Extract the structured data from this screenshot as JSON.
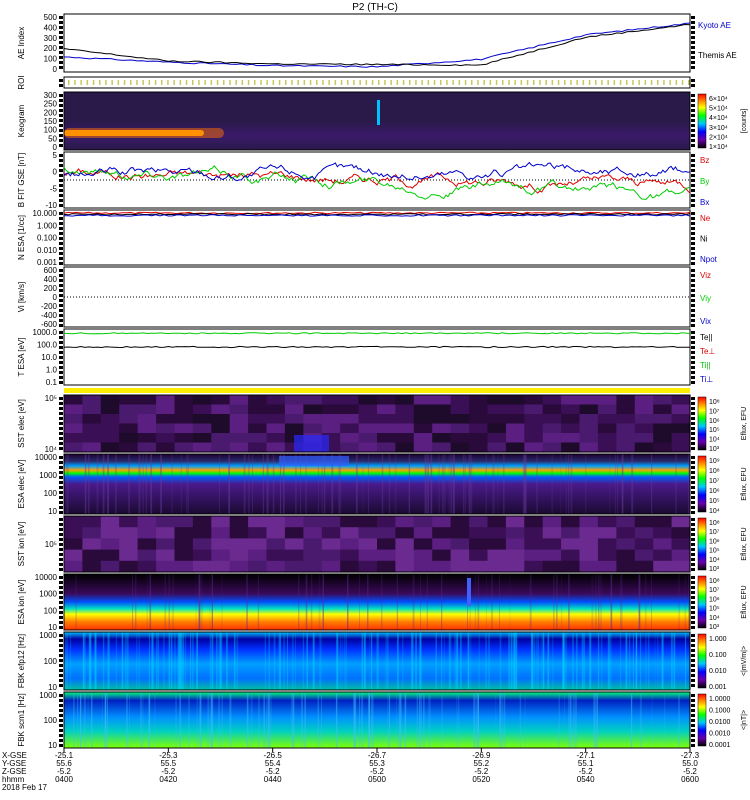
{
  "title": "P2 (TH-C)",
  "footer": {
    "row_labels": [
      "X-GSE",
      "Y-GSE",
      "Z-GSE",
      "hhmm",
      "2018 Feb 17"
    ],
    "columns": [
      {
        "values": [
          "-25.1",
          "55.6",
          "-5.2",
          "0400"
        ]
      },
      {
        "values": [
          "-25.3",
          "55.5",
          "-5.2",
          "0420"
        ]
      },
      {
        "values": [
          "-26.5",
          "55.4",
          "-5.2",
          "0440"
        ]
      },
      {
        "values": [
          "-26.7",
          "55.3",
          "-5.2",
          "0500"
        ]
      },
      {
        "values": [
          "-26.9",
          "55.2",
          "-5.2",
          "0520"
        ]
      },
      {
        "values": [
          "-27.1",
          "55.1",
          "-5.2",
          "0540"
        ]
      },
      {
        "values": [
          "-27.3",
          "55.0",
          "-5.2",
          "0600"
        ]
      }
    ]
  },
  "colors": {
    "blue": "#0000cc",
    "red": "#dd0000",
    "green": "#00cc00",
    "black": "#000000",
    "yellow": "#ffee00"
  },
  "chart_data": [
    {
      "type": "line",
      "panel": "AE",
      "ylabel": "AE Index",
      "ylim": [
        0,
        500
      ],
      "y_ticks": [
        "500",
        "400",
        "300",
        "200",
        "100",
        "0"
      ],
      "x": [
        "0400",
        "0420",
        "0440",
        "0500",
        "0520",
        "0540",
        "0600"
      ],
      "series": [
        {
          "name": "Kyoto AE",
          "color": "#0000cc",
          "values": [
            130,
            85,
            55,
            45,
            110,
            320,
            420
          ]
        },
        {
          "name": "Themis AE",
          "color": "#000000",
          "values": [
            200,
            95,
            70,
            65,
            60,
            300,
            410
          ]
        }
      ]
    },
    {
      "type": "heatmap",
      "panel": "ROI",
      "ylabel": "ROI"
    },
    {
      "type": "heatmap",
      "panel": "Keogram",
      "ylabel": "Keogram",
      "y_ticks": [
        "300",
        "250",
        "200",
        "150",
        "100",
        "50",
        "0"
      ],
      "colorbar": {
        "label": "[counts]",
        "ticks": [
          "6×10⁴",
          "5×10⁴",
          "4×10⁴",
          "3×10⁴",
          "2×10⁴",
          "1×10⁴"
        ]
      }
    },
    {
      "type": "line",
      "panel": "B_FIT",
      "ylabel": "B FIT GSE [nT]",
      "ylim": [
        -10,
        10
      ],
      "y_ticks": [
        "5",
        "0",
        "-5",
        "-10"
      ],
      "series": [
        {
          "name": "Bz",
          "color": "#dd0000"
        },
        {
          "name": "By",
          "color": "#00cc00"
        },
        {
          "name": "Bx",
          "color": "#0000cc"
        }
      ]
    },
    {
      "type": "line",
      "panel": "Density",
      "ylabel": "N ESA [1/cc]",
      "y_ticks": [
        "10.000",
        "1.000",
        "0.100",
        "0.010",
        "0.001"
      ],
      "series": [
        {
          "name": "Ne",
          "color": "#dd0000"
        },
        {
          "name": "Ni",
          "color": "#000000"
        },
        {
          "name": "Npot",
          "color": "#0000cc"
        }
      ]
    },
    {
      "type": "line",
      "panel": "Velocity",
      "ylabel": "Vi [km/s]",
      "ylim": [
        -600,
        600
      ],
      "y_ticks": [
        "600",
        "400",
        "200",
        "0",
        "-200",
        "-400",
        "-600"
      ],
      "series": [
        {
          "name": "Viz",
          "color": "#dd0000"
        },
        {
          "name": "Viy",
          "color": "#00cc00"
        },
        {
          "name": "Vix",
          "color": "#0000cc"
        }
      ]
    },
    {
      "type": "line",
      "panel": "Temperature",
      "ylabel": "T ESA [eV]",
      "y_ticks": [
        "1000.0",
        "100.0",
        "10.0",
        "1.0",
        "0.1"
      ],
      "series": [
        {
          "name": "Te||",
          "color": "#000000"
        },
        {
          "name": "Te⊥",
          "color": "#dd0000"
        },
        {
          "name": "Ti||",
          "color": "#00cc00"
        },
        {
          "name": "Ti⊥",
          "color": "#0000cc"
        }
      ]
    },
    {
      "type": "heatmap",
      "panel": "SST_e",
      "ylabel": "SST elec [eV]",
      "y_ticks": [
        "10⁵",
        "10⁴"
      ],
      "colorbar": {
        "label": "Eflux, EFU",
        "ticks": [
          "10⁸",
          "10⁷",
          "10⁶",
          "10⁵",
          "10⁴",
          "10³"
        ]
      }
    },
    {
      "type": "heatmap",
      "panel": "ESA_e",
      "ylabel": "ESA elec [eV]",
      "y_ticks": [
        "10000",
        "1000",
        "100",
        "10"
      ],
      "colorbar": {
        "label": "Eflux, EFU",
        "ticks": [
          "10⁹",
          "10⁸",
          "10⁷",
          "10⁶",
          "10⁵",
          "10⁴"
        ]
      }
    },
    {
      "type": "heatmap",
      "panel": "SST_i",
      "ylabel": "SST ion [eV]",
      "y_ticks": [
        "10⁵"
      ],
      "colorbar": {
        "label": "Eflux, EFU",
        "ticks": [
          "10⁸",
          "10⁷",
          "10⁶",
          "10⁵",
          "10⁴",
          "10³"
        ]
      }
    },
    {
      "type": "heatmap",
      "panel": "ESA_i",
      "ylabel": "ESA ion [eV]",
      "y_ticks": [
        "10000",
        "1000",
        "100",
        "10"
      ],
      "colorbar": {
        "label": "Eflux, EFU",
        "ticks": [
          "10⁸",
          "10⁷",
          "10⁶",
          "10⁵",
          "10⁴",
          "10³"
        ]
      }
    },
    {
      "type": "heatmap",
      "panel": "FBK_E",
      "ylabel": "FBK efp12 [Hz]",
      "y_ticks": [
        "1000",
        "100",
        "10"
      ],
      "colorbar": {
        "label": "<|mV/m|>",
        "ticks": [
          "1.000",
          "0.100",
          "0.010",
          "0.001"
        ]
      }
    },
    {
      "type": "heatmap",
      "panel": "FBK_B",
      "ylabel": "FBK scm1 [Hz]",
      "y_ticks": [
        "1000",
        "100",
        "10"
      ],
      "colorbar": {
        "label": "<|nT|>",
        "ticks": [
          "1.0000",
          "0.1000",
          "0.0100",
          "0.0010",
          "0.0001"
        ]
      }
    }
  ]
}
